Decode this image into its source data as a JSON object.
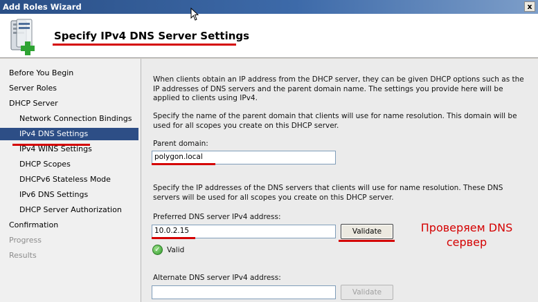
{
  "window": {
    "title": "Add Roles Wizard",
    "close_glyph": "x"
  },
  "header": {
    "title": "Specify IPv4 DNS Server Settings",
    "icon": "server-roles-add-icon"
  },
  "sidebar": {
    "items": [
      {
        "label": "Before You Begin",
        "level": 0,
        "state": "normal"
      },
      {
        "label": "Server Roles",
        "level": 0,
        "state": "normal"
      },
      {
        "label": "DHCP Server",
        "level": 0,
        "state": "normal"
      },
      {
        "label": "Network Connection Bindings",
        "level": 1,
        "state": "normal"
      },
      {
        "label": "IPv4 DNS Settings",
        "level": 1,
        "state": "selected"
      },
      {
        "label": "IPv4 WINS Settings",
        "level": 1,
        "state": "normal"
      },
      {
        "label": "DHCP Scopes",
        "level": 1,
        "state": "normal"
      },
      {
        "label": "DHCPv6 Stateless Mode",
        "level": 1,
        "state": "normal"
      },
      {
        "label": "IPv6 DNS Settings",
        "level": 1,
        "state": "normal"
      },
      {
        "label": "DHCP Server Authorization",
        "level": 1,
        "state": "normal"
      },
      {
        "label": "Confirmation",
        "level": 0,
        "state": "normal"
      },
      {
        "label": "Progress",
        "level": 0,
        "state": "disabled"
      },
      {
        "label": "Results",
        "level": 0,
        "state": "disabled"
      }
    ]
  },
  "content": {
    "intro": "When clients obtain an IP address from the DHCP server, they can be given DHCP options such as the IP addresses of DNS servers and the parent domain name. The settings you provide here will be applied to clients using IPv4.",
    "domain_desc": "Specify the name of the parent domain that clients will use for name resolution. This domain will be used for all scopes you create on this DHCP server.",
    "parent_domain_label": "Parent domain:",
    "parent_domain_value": "polygon.local",
    "dns_desc": "Specify the IP addresses of the DNS servers that clients will use for name resolution. These DNS servers will be used for all scopes you create on this DHCP server.",
    "preferred_label": "Preferred DNS server IPv4 address:",
    "preferred_value": "10.0.2.15",
    "validate_label": "Validate",
    "valid_text": "Valid",
    "alternate_label": "Alternate DNS server IPv4 address:",
    "alternate_value": "",
    "validate2_label": "Validate"
  },
  "annotation": {
    "line1": "Проверяем DNS",
    "line2": "сервер",
    "color": "#d40000"
  },
  "colors": {
    "selection": "#2d4e86",
    "titlebar": "#3d6aa9",
    "markup": "#d40000"
  }
}
